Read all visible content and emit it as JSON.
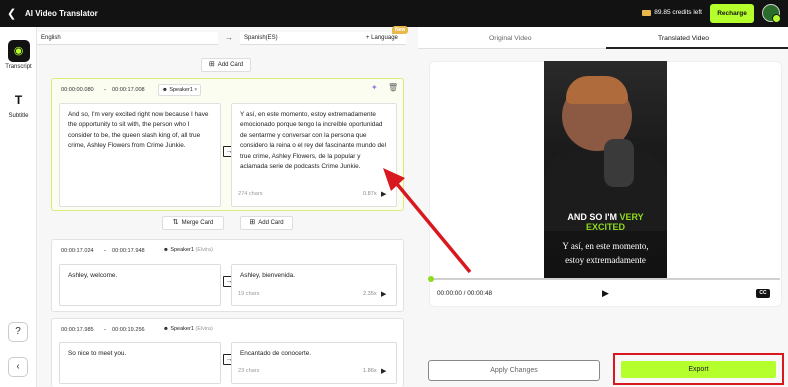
{
  "app": {
    "title": "AI Video Translator",
    "back_icon": "chevron-left-icon"
  },
  "header": {
    "credits": "89.85 credits left",
    "recharge_label": "Recharge"
  },
  "tools": [
    {
      "label": "Transcript",
      "icon": "transcript-icon"
    },
    {
      "label": "Subtitle",
      "icon": "subtitle-icon"
    }
  ],
  "languages": {
    "source": "English",
    "target": "Spanish(ES)",
    "add_label": "+ Language",
    "new_badge": "New"
  },
  "buttons": {
    "add_card": "Add Card",
    "merge_card": "Merge Card",
    "apply": "Apply Changes",
    "export": "Export"
  },
  "cards": [
    {
      "start": "00:00:00.080",
      "end": "00:00:17.008",
      "dash": "-",
      "speaker": "Speaker1",
      "speaker_voice": "",
      "source": "And so, I'm very excited right now because I have the opportunity to sit with, the person who I consider to be, the queen slash king of, all true crime, Ashley Flowers from Crime Junkie.",
      "target": "Y así, en este momento, estoy extremadamente emocionado porque tengo la increíble oportunidad de sentarme y conversar con la persona que considero la reina o el rey del fascinante mundo del true crime, Ashley Flowers, de la popular y aclamada serie de podcasts Crime Junkie.",
      "chars": "274 chars",
      "speed": "0.87x"
    },
    {
      "start": "00:00:17.024",
      "end": "00:00:17.948",
      "dash": "-",
      "speaker": "Speaker1",
      "speaker_voice": "(Elvira)",
      "source": "Ashley, welcome.",
      "target": "Ashley, bienvenida.",
      "chars": "19 chars",
      "speed": "2.35x"
    },
    {
      "start": "00:00:17.985",
      "end": "00:00:19.256",
      "dash": "-",
      "speaker": "Speaker1",
      "speaker_voice": "(Elvira)",
      "source": "So nice to meet you.",
      "target": "Encantado de conocerte.",
      "chars": "23 chars",
      "speed": "1.86x"
    }
  ],
  "preview": {
    "tabs": [
      "Original Video",
      "Translated Video"
    ],
    "active_tab": "Translated Video",
    "caption_en_1": "AND SO I'M",
    "caption_en_highlight": "VERY",
    "caption_en_2": "EXCITED",
    "caption_es_1": "Y así, en este momento,",
    "caption_es_2": "estoy extremadamente",
    "time": "00:00:00 / 00:00:48",
    "cc": "CC",
    "progress": 0
  },
  "colors": {
    "accent": "#b4ff2c",
    "annotation": "#d8171f",
    "topbar": "#121212"
  }
}
